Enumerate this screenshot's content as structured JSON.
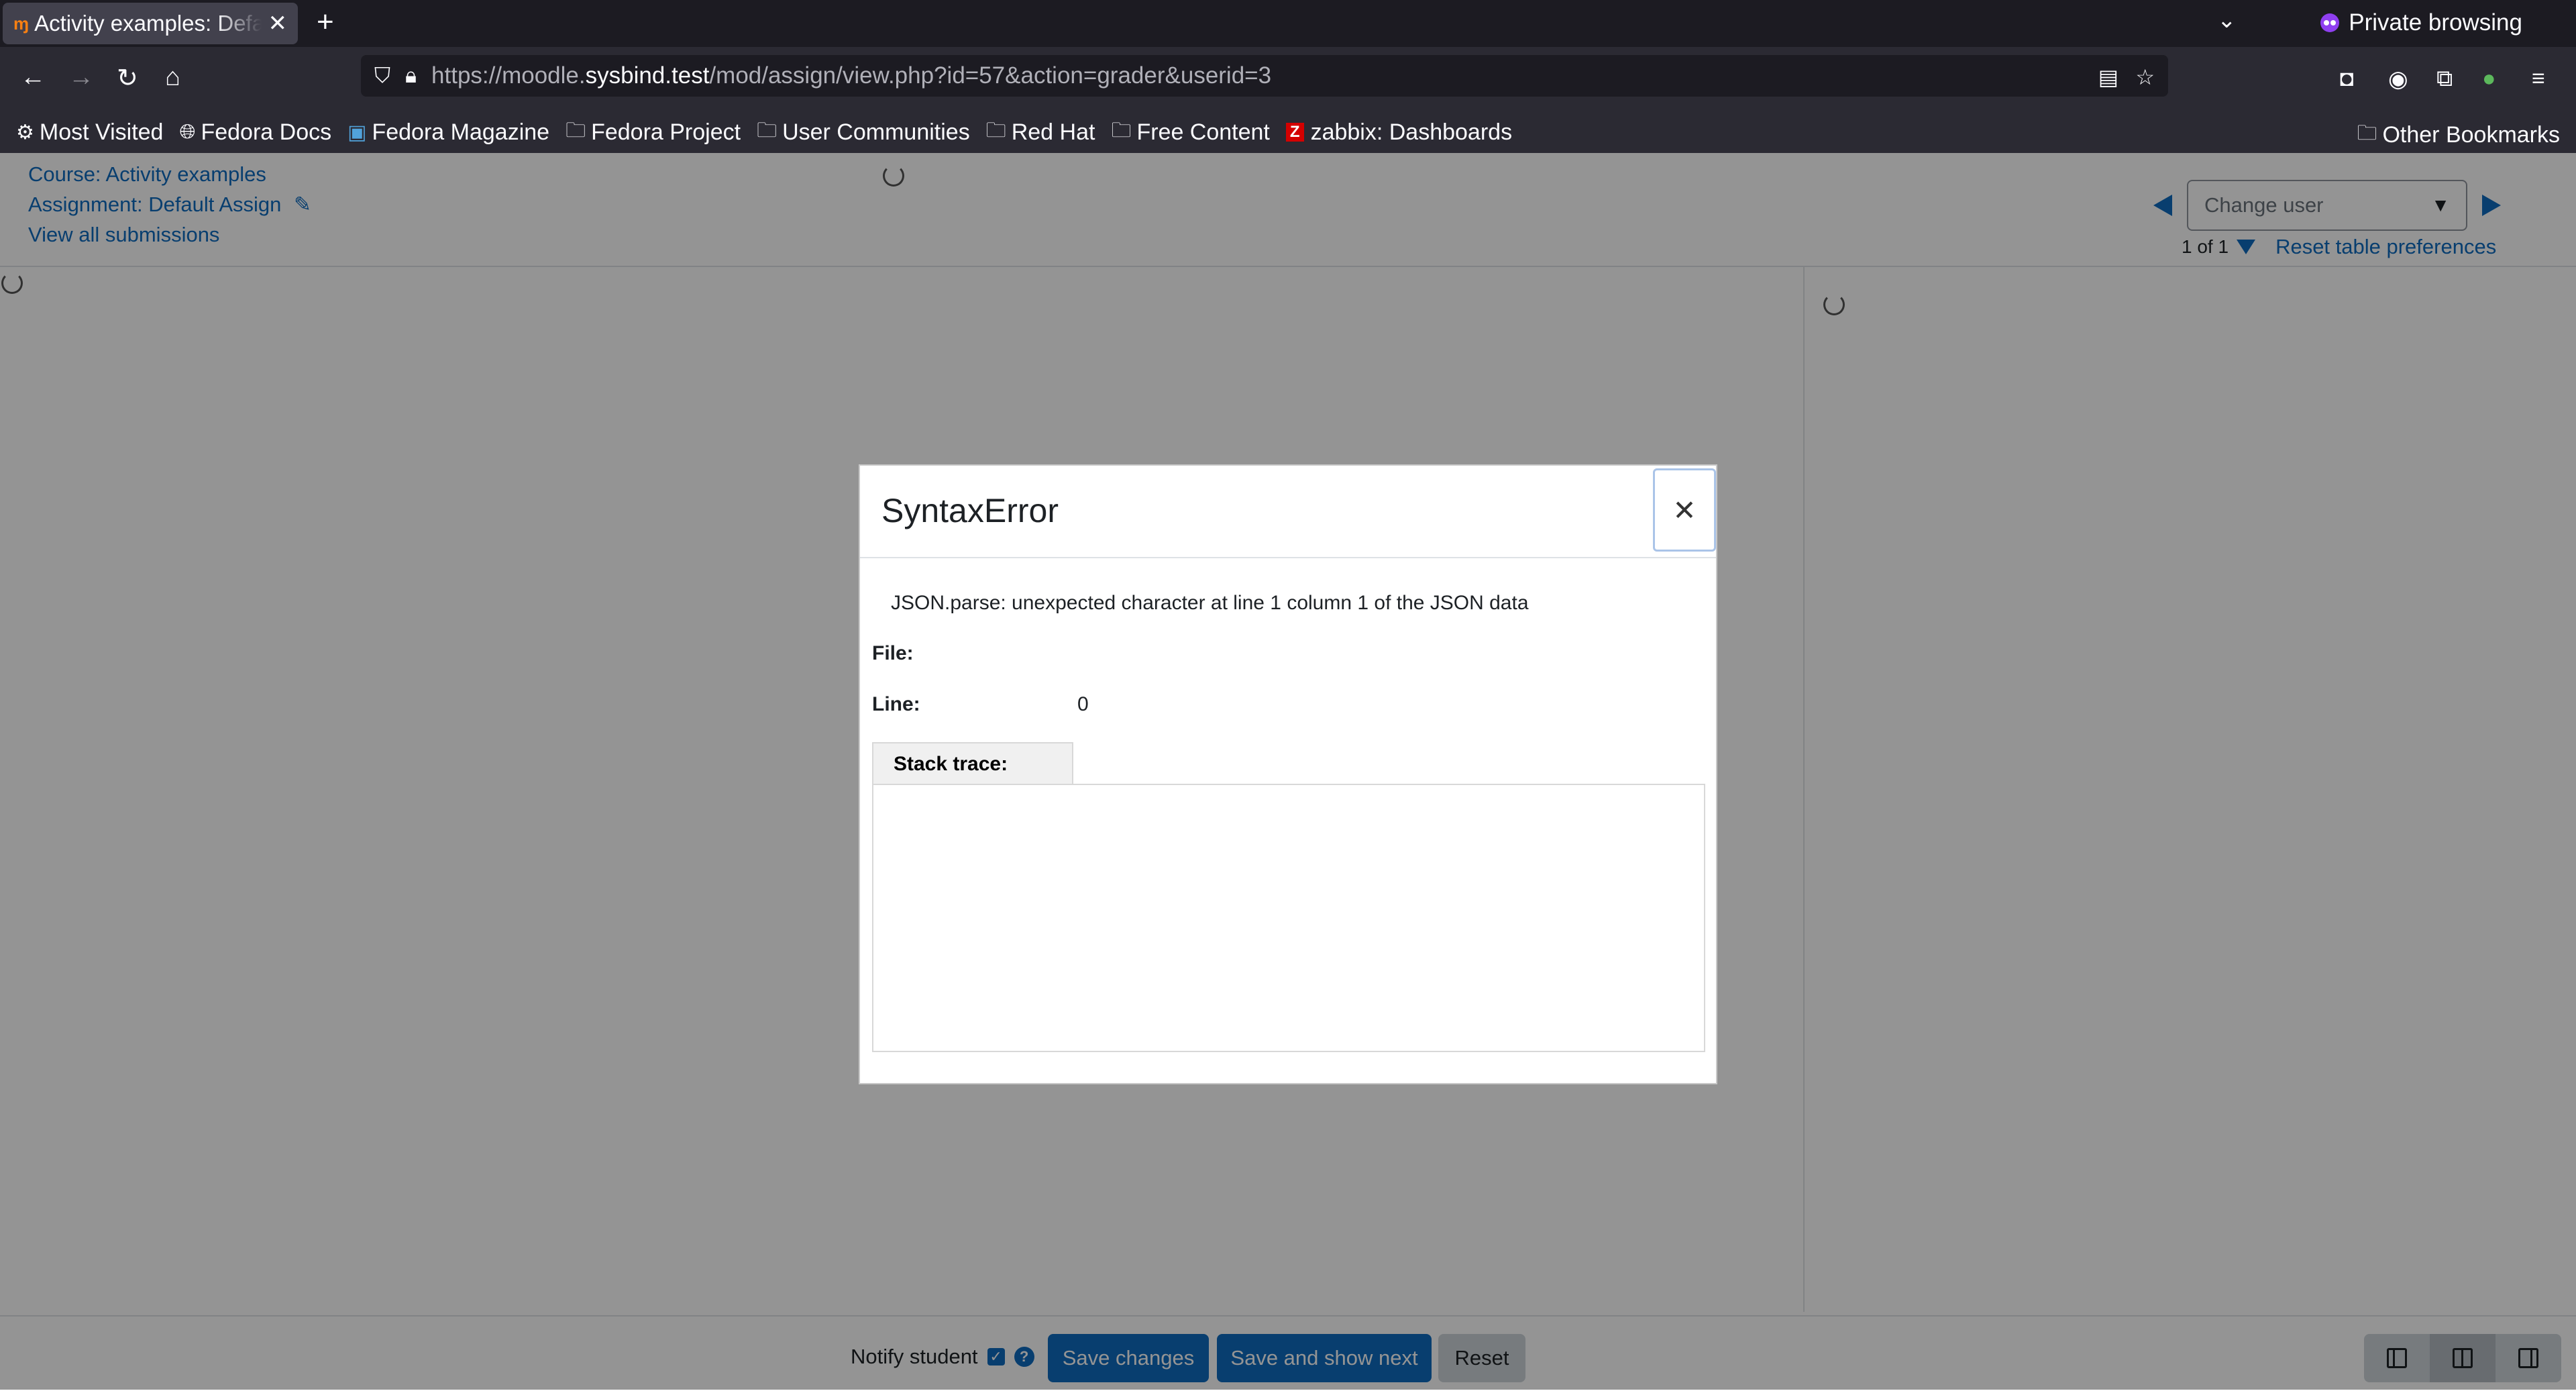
{
  "browser": {
    "tab": {
      "favicon": "moodle-icon",
      "title": "Activity examples: Default Assign"
    },
    "private_label": "Private browsing",
    "url": {
      "prefix": "https://moodle.",
      "domain": "sysbind.test",
      "path": "/mod/assign/view.php?id=57&action=grader&userid=3"
    },
    "bookmarks": [
      {
        "icon": "gear-icon",
        "label": "Most Visited"
      },
      {
        "icon": "globe-icon",
        "label": "Fedora Docs"
      },
      {
        "icon": "fm-icon",
        "label": "Fedora Magazine"
      },
      {
        "icon": "folder-icon",
        "label": "Fedora Project"
      },
      {
        "icon": "folder-icon",
        "label": "User Communities"
      },
      {
        "icon": "folder-icon",
        "label": "Red Hat"
      },
      {
        "icon": "folder-icon",
        "label": "Free Content"
      },
      {
        "icon": "zabbix-icon",
        "label": "zabbix: Dashboards"
      }
    ],
    "other_bookmarks": "Other Bookmarks"
  },
  "grader": {
    "course_link": "Course: Activity examples",
    "assignment_link": "Assignment: Default Assign",
    "view_all": "View all submissions",
    "change_user_placeholder": "Change user",
    "count": "1 of 1",
    "reset_preferences": "Reset table preferences"
  },
  "footer": {
    "notify_label": "Notify student",
    "notify_checked": true,
    "save_changes": "Save changes",
    "save_next": "Save and show next",
    "reset": "Reset"
  },
  "modal": {
    "title": "SyntaxError",
    "message": "JSON.parse: unexpected character at line 1 column 1 of the JSON data",
    "file_label": "File:",
    "file_value": "",
    "line_label": "Line:",
    "line_value": "0",
    "stack_label": "Stack trace:",
    "stack_value": ""
  },
  "colors": {
    "link": "#0f6cbf",
    "primary": "#0f6cbf",
    "chrome_dark": "#1c1b22",
    "chrome": "#2b2a33"
  }
}
